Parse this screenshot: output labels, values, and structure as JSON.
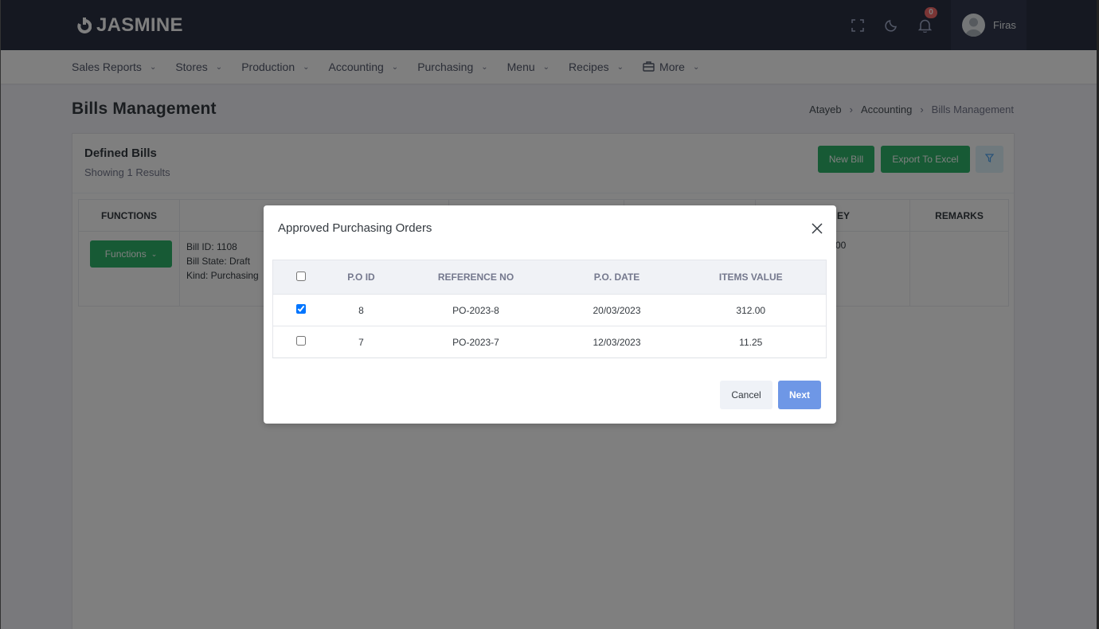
{
  "app": {
    "logo_text": "JASMINE"
  },
  "header": {
    "notification_count": "0",
    "user_name": "Firas"
  },
  "nav": {
    "items": [
      {
        "label": "Sales Reports"
      },
      {
        "label": "Stores"
      },
      {
        "label": "Production"
      },
      {
        "label": "Accounting"
      },
      {
        "label": "Purchasing"
      },
      {
        "label": "Menu"
      },
      {
        "label": "Recipes"
      },
      {
        "label": "More"
      }
    ]
  },
  "page": {
    "title": "Bills Management",
    "breadcrumb": [
      "Atayeb",
      "Accounting",
      "Bills Management"
    ]
  },
  "card": {
    "title": "Defined Bills",
    "subtitle": "Showing 1 Results",
    "new_bill_label": "New Bill",
    "export_label": "Export To Excel",
    "table": {
      "headers": {
        "functions": "FUNCTIONS",
        "money_partial": "EY",
        "remarks": "REMARKS"
      },
      "row": {
        "functions_label": "Functions",
        "bill_id": "Bill ID: 1108",
        "bill_state": "Bill State: Draft",
        "kind": "Kind: Purchasing",
        "money_partial": "00"
      }
    }
  },
  "modal": {
    "title": "Approved Purchasing Orders",
    "headers": {
      "po_id": "P.O ID",
      "reference_no": "REFERENCE NO",
      "po_date": "P.O. DATE",
      "items_value": "ITEMS VALUE"
    },
    "rows": [
      {
        "checked": true,
        "po_id": "8",
        "reference_no": "PO-2023-8",
        "po_date": "20/03/2023",
        "items_value": "312.00"
      },
      {
        "checked": false,
        "po_id": "7",
        "reference_no": "PO-2023-7",
        "po_date": "12/03/2023",
        "items_value": "11.25"
      }
    ],
    "cancel_label": "Cancel",
    "next_label": "Next"
  }
}
